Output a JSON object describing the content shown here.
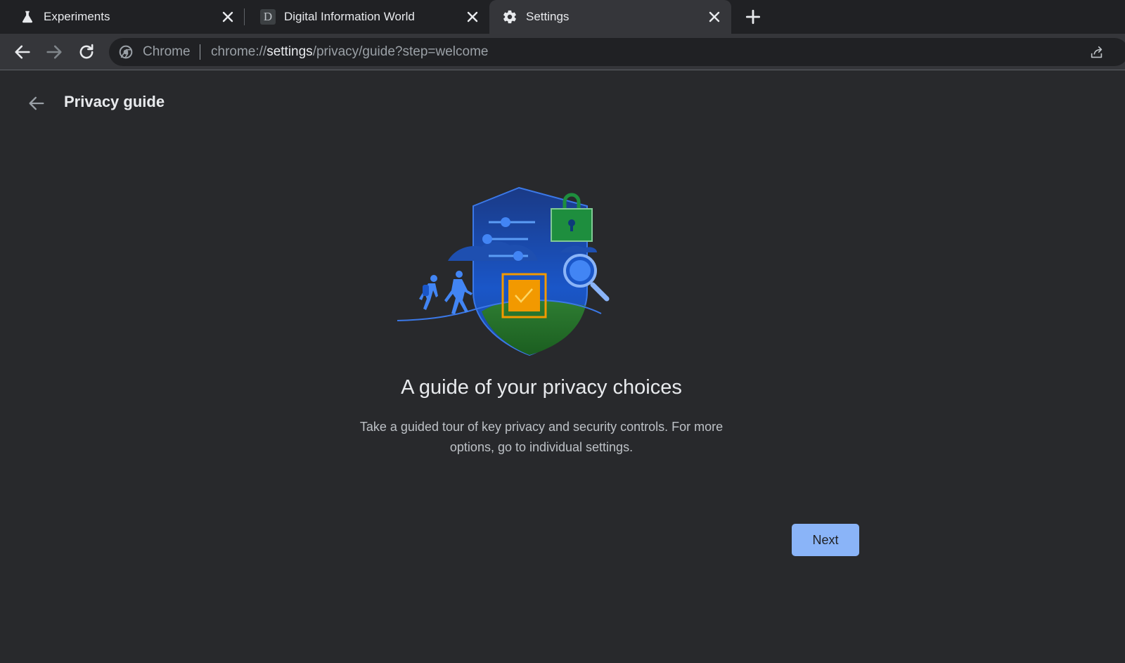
{
  "browser": {
    "tabs": [
      {
        "label": "Experiments",
        "icon": "flask-icon",
        "active": false
      },
      {
        "label": "Digital Information World",
        "icon": "site-favicon-d",
        "favicon_text": "D",
        "active": false
      },
      {
        "label": "Settings",
        "icon": "gear-icon",
        "active": true
      }
    ],
    "omnibox": {
      "chip_label": "Chrome",
      "url_scheme": "chrome://",
      "url_host": "settings",
      "url_path": "/privacy/guide?step=welcome"
    }
  },
  "page": {
    "title": "Privacy guide",
    "headline": "A guide of your privacy choices",
    "description": "Take a guided tour of key privacy and security controls. For more options, go to individual settings.",
    "next_label": "Next"
  },
  "colors": {
    "tabstrip_bg": "#202124",
    "toolbar_bg": "#35363a",
    "page_bg": "#28292c",
    "accent_blue": "#8ab4f8",
    "shield_blue": "#1a56c8",
    "lock_green": "#1e8e3e",
    "check_orange": "#f29900"
  }
}
